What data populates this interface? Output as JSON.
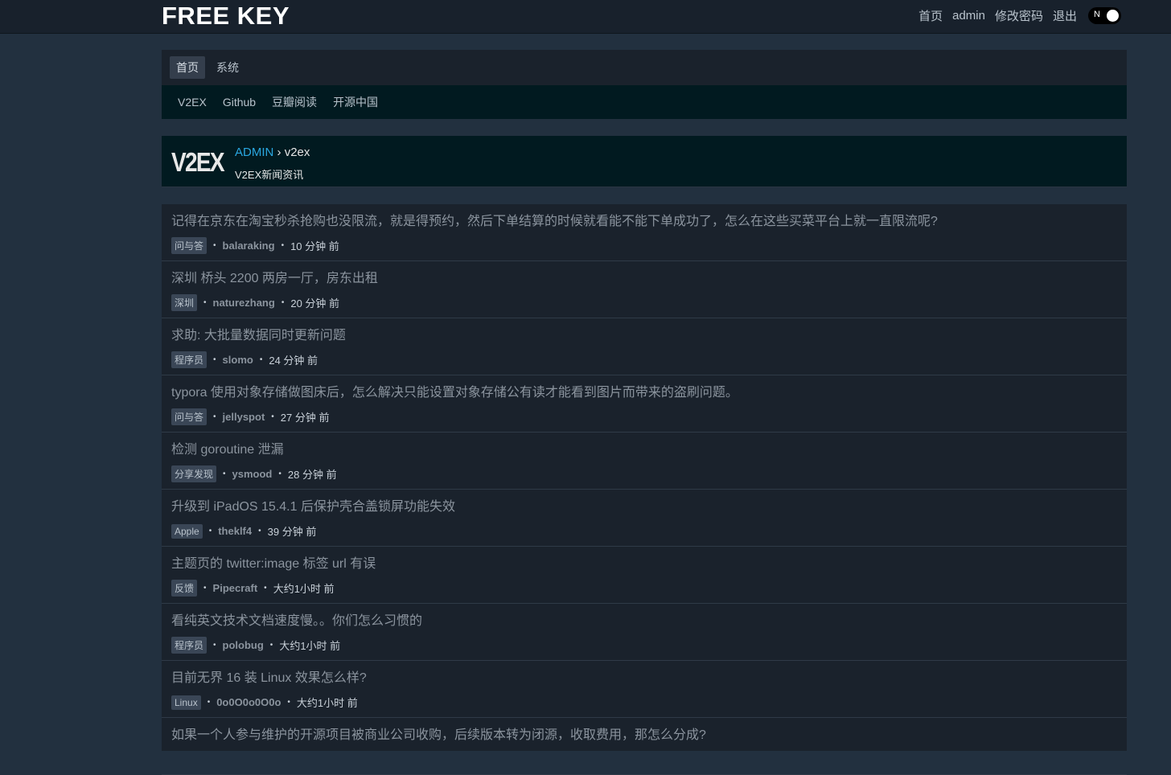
{
  "brand": "FREE KEY",
  "topnav": {
    "home": "首页",
    "user": "admin",
    "change_password": "修改密码",
    "logout": "退出",
    "toggle_label": "N"
  },
  "tabs": [
    {
      "label": "首页"
    },
    {
      "label": "系统"
    }
  ],
  "sublinks": [
    {
      "label": "V2EX"
    },
    {
      "label": "Github"
    },
    {
      "label": "豆瓣阅读"
    },
    {
      "label": "开源中国"
    }
  ],
  "header": {
    "logo_text": "V2EX",
    "crumb_admin": "ADMIN",
    "crumb_sep": " › ",
    "crumb_page": "v2ex",
    "description": "V2EX新闻资讯"
  },
  "items": [
    {
      "title": "记得在京东在淘宝秒杀抢购也没限流，就是得预约，然后下单结算的时候就看能不能下单成功了，怎么在这些买菜平台上就一直限流呢?",
      "tag": "问与答",
      "author": "balaraking",
      "time": "10 分钟 前"
    },
    {
      "title": "深圳 桥头 2200 两房一厅，房东出租",
      "tag": "深圳",
      "author": "naturezhang",
      "time": "20 分钟 前"
    },
    {
      "title": "求助: 大批量数据同时更新问题",
      "tag": "程序员",
      "author": "slomo",
      "time": "24 分钟 前"
    },
    {
      "title": "typora 使用对象存储做图床后，怎么解决只能设置对象存储公有读才能看到图片而带来的盗刷问题。",
      "tag": "问与答",
      "author": "jellyspot",
      "time": "27 分钟 前"
    },
    {
      "title": "检测 goroutine 泄漏",
      "tag": "分享发现",
      "author": "ysmood",
      "time": "28 分钟 前"
    },
    {
      "title": "升级到 iPadOS 15.4.1 后保护壳合盖锁屏功能失效",
      "tag": "Apple",
      "author": "theklf4",
      "time": "39 分钟 前"
    },
    {
      "title": "主题页的 twitter:image 标签 url 有误",
      "tag": "反馈",
      "author": "Pipecraft",
      "time": "大约1小时 前"
    },
    {
      "title": "看纯英文技术文档速度慢。。你们怎么习惯的",
      "tag": "程序员",
      "author": "polobug",
      "time": "大约1小时 前"
    },
    {
      "title": "目前无界 16 装 Linux 效果怎么样?",
      "tag": "Linux",
      "author": "0o0O0o0O0o",
      "time": "大约1小时 前"
    },
    {
      "title": "如果一个人参与维护的开源项目被商业公司收购，后续版本转为闭源，收取费用，那怎么分成?",
      "tag": "",
      "author": "",
      "time": ""
    }
  ]
}
